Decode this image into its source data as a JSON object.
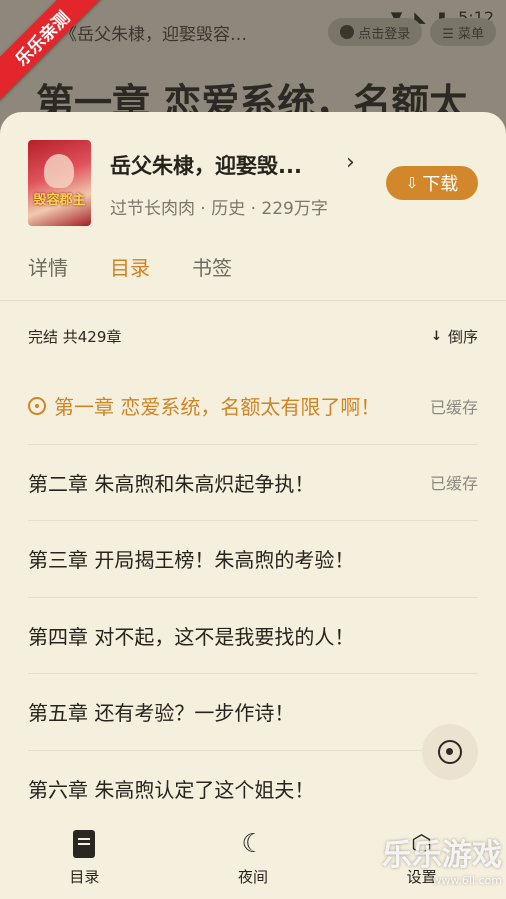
{
  "status_bar": {
    "time": "5:12"
  },
  "reader_top": {
    "book_title": "《岳父朱棣，迎娶毁容…",
    "login_pill": "点击登录",
    "menu_pill": "☰ 菜单",
    "chapter_heading": "第一章 恋爱系统，名额太"
  },
  "ribbon": "乐乐亲测",
  "book": {
    "title": "岳父朱棣，迎娶毁...",
    "meta": "过节长肉肉 · 历史 · 229万字",
    "download_label": "下载",
    "cover_text": "毁容郡主"
  },
  "tabs": [
    {
      "label": "详情",
      "active": false
    },
    {
      "label": "目录",
      "active": true
    },
    {
      "label": "书签",
      "active": false
    }
  ],
  "list": {
    "status": "完结 共429章",
    "sort_label": "倒序"
  },
  "chapters": [
    {
      "title": "第一章 恋爱系统，名额太有限了啊！",
      "cache": "已缓存",
      "current": true
    },
    {
      "title": "第二章 朱高煦和朱高炽起争执！",
      "cache": "已缓存",
      "current": false
    },
    {
      "title": "第三章 开局揭王榜！朱高煦的考验！",
      "cache": "",
      "current": false
    },
    {
      "title": "第四章 对不起，这不是我要找的人！",
      "cache": "",
      "current": false
    },
    {
      "title": "第五章 还有考验？一步作诗！",
      "cache": "",
      "current": false
    },
    {
      "title": "第六章 朱高煦认定了这个姐夫！",
      "cache": "",
      "current": false
    }
  ],
  "bottom_nav": [
    {
      "label": "目录",
      "icon": "catalog-icon"
    },
    {
      "label": "夜间",
      "icon": "moon-icon"
    },
    {
      "label": "设置",
      "icon": "settings-icon"
    }
  ],
  "watermark": {
    "text": "乐乐游戏",
    "url": "www.6ll.com"
  },
  "colors": {
    "accent": "#d08525",
    "sheet_bg": "#f5efde",
    "download_bg": "#d2882a"
  }
}
